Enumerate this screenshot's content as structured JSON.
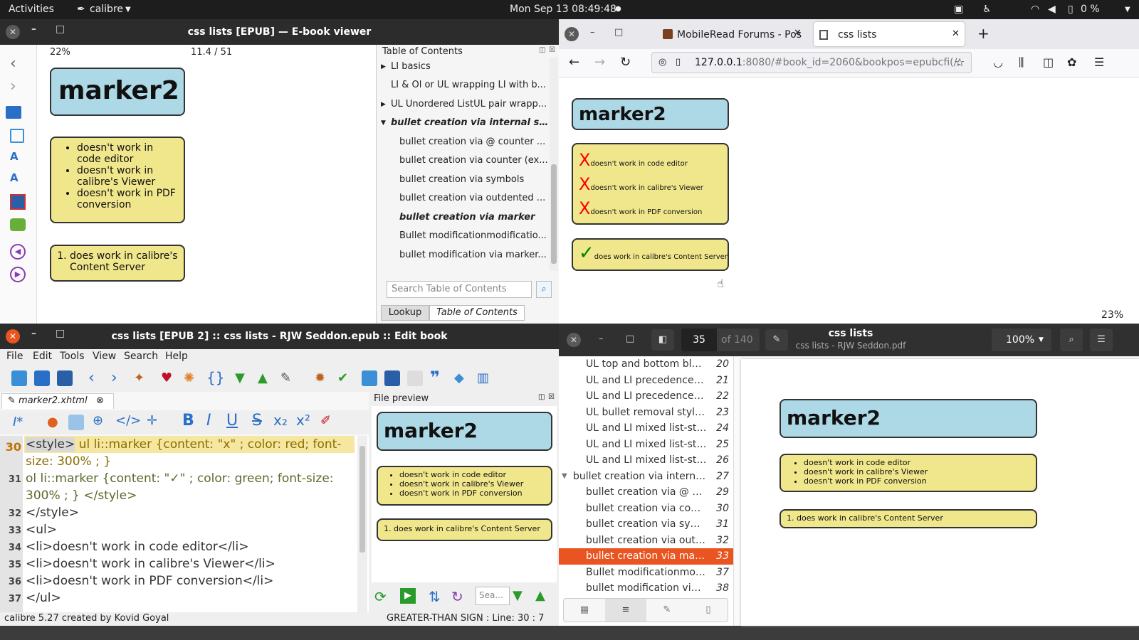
{
  "topbar": {
    "activities": "Activities",
    "app": "calibre",
    "clock": "Mon Sep 13  08:49:48",
    "battery": "0 %"
  },
  "viewer": {
    "title": "css lists [EPUB] — E-book viewer",
    "progress": "22%",
    "pages": "11.4 / 51",
    "marker_title": "marker2",
    "ul_items": [
      "doesn't work in code editor",
      "doesn't work in calibre's Viewer",
      "doesn't work in PDF conversion"
    ],
    "ol_item": "does work in calibre's Content Server",
    "toc_header": "Table of Contents",
    "toc": [
      "LI basics",
      "LI & Ol or UL wrapping LI with b...",
      "UL Unordered ListUL pair wrapp...",
      "bullet creation via internal s...",
      "bullet creation via @ counter ...",
      "bullet creation via counter (ex...",
      "bullet creation via symbols",
      "bullet creation via outdented ...",
      "bullet creation via marker",
      "Bullet modificationmodificatio...",
      "bullet modification via marker..."
    ],
    "search_placeholder": "Search Table of Contents",
    "tab_lookup": "Lookup",
    "tab_toc": "Table of Contents"
  },
  "browser": {
    "tab1": "MobileRead Forums - Pos",
    "tab2": "css lists",
    "url_host": "127.0.0.1",
    "url_rest": ":8080/#book_id=2060&bookpos=epubcfi(/:",
    "marker_title": "marker2",
    "x_items": [
      "doesn't work in code editor",
      "doesn't work in calibre's Viewer",
      "doesn't work in PDF conversion"
    ],
    "check_item": "does work in calibre's Content Server",
    "progress": "23%"
  },
  "editor": {
    "title": "css lists [EPUB 2] :: css lists - RJW Seddon.epub :: Edit book",
    "menu": [
      "File",
      "Edit",
      "Tools",
      "View",
      "Search",
      "Help"
    ],
    "file_tab": "marker2.xhtml",
    "line_numbers": [
      "30",
      "31",
      "32",
      "33",
      "34",
      "35",
      "36",
      "37"
    ],
    "code": {
      "l30a": "<style>",
      "l30b": " ul li::marker {content: \"x\" ; color: red; font-",
      "l30c": "size: 300% ; }",
      "l31a": "ol li::marker {content: \"✓\" ; color: green; font-size:",
      "l31b": "300% ; } </style>",
      "l32": "</style>",
      "l33": "  <ul>",
      "l34": "<li>doesn't work in code editor</li>",
      "l35": "<li>doesn't work in calibre's Viewer</li>",
      "l36": "<li>doesn't work in PDF conversion</li>",
      "l37": "</ul>"
    },
    "preview_header": "File preview",
    "preview_marker": "marker2",
    "preview_ul": [
      "doesn't work in code editor",
      "doesn't work in calibre's Viewer",
      "doesn't work in PDF conversion"
    ],
    "preview_ol": "does work in calibre's Content Server",
    "preview_search": "Sea...",
    "status_left": "calibre 5.27 created by Kovid Goyal",
    "status_right": "GREATER-THAN SIGN : Line: 30 : 7"
  },
  "pdf": {
    "page": "35",
    "of": "of 140",
    "title": "css lists",
    "subtitle": "css lists - RJW Seddon.pdf",
    "zoom": "100%",
    "toc": [
      {
        "t": "UL top and bottom bla...",
        "p": "20"
      },
      {
        "t": "UL and LI precedence o...",
        "p": "21"
      },
      {
        "t": "UL and LI precedence o...",
        "p": "22"
      },
      {
        "t": "UL bullet removal style...",
        "p": "23"
      },
      {
        "t": "UL and LI mixed list-styl...",
        "p": "24"
      },
      {
        "t": "UL and LI mixed list-styl...",
        "p": "25"
      },
      {
        "t": "UL and LI mixed list-styl...",
        "p": "26"
      },
      {
        "t": "bullet creation via internal...",
        "p": "27"
      },
      {
        "t": "bullet creation via @ co...",
        "p": "29"
      },
      {
        "t": "bullet creation via coun...",
        "p": "30"
      },
      {
        "t": "bullet creation via symb...",
        "p": "31"
      },
      {
        "t": "bullet creation via outd...",
        "p": "32"
      },
      {
        "t": "bullet creation via marker",
        "p": "33"
      },
      {
        "t": "Bullet modificationmod...",
        "p": "37"
      },
      {
        "t": "bullet modification via ...",
        "p": "38"
      }
    ],
    "marker_title": "marker2",
    "ul_items": [
      "doesn't work in code editor",
      "doesn't work in calibre's Viewer",
      "doesn't work in PDF conversion"
    ],
    "ol_item": "does work in calibre's Content Server"
  }
}
